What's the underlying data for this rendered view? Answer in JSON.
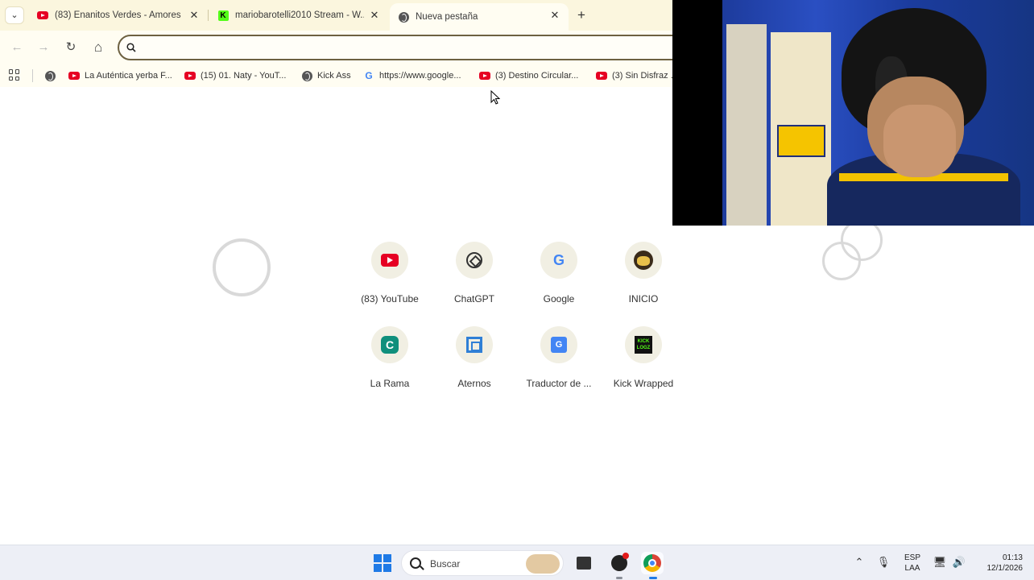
{
  "browser": {
    "tabs": [
      {
        "title": "(83) Enanitos Verdes - Amores ...",
        "favicon": "youtube-icon",
        "active": false
      },
      {
        "title": "mariobarotelli2010 Stream - W...",
        "favicon": "kick-icon",
        "active": false
      },
      {
        "title": "Nueva pestaña",
        "favicon": "globe-icon",
        "active": true
      }
    ],
    "tab_close_glyph": "✕",
    "new_tab_glyph": "+",
    "tab_menu_glyph": "⌄",
    "toolbar": {
      "back_glyph": "←",
      "forward_glyph": "→",
      "reload_glyph": "↻",
      "home_glyph": "⌂",
      "omnibox_value": ""
    },
    "bookmarks": [
      {
        "label": "",
        "favicon": "globe-icon"
      },
      {
        "label": "La Auténtica yerba F...",
        "favicon": "youtube-icon"
      },
      {
        "label": "(15) 01. Naty - YouT...",
        "favicon": "youtube-icon"
      },
      {
        "label": "Kick Ass",
        "favicon": "globe-icon"
      },
      {
        "label": "https://www.google...",
        "favicon": "google-icon"
      },
      {
        "label": "(3) Destino Circular...",
        "favicon": "youtube-icon"
      },
      {
        "label": "(3) Sin Disfraz ...",
        "favicon": "youtube-icon"
      }
    ]
  },
  "new_tab_page": {
    "shortcuts": [
      {
        "label": "(83) YouTube",
        "icon": "youtube-icon"
      },
      {
        "label": "ChatGPT",
        "icon": "chatgpt-icon"
      },
      {
        "label": "Google",
        "icon": "google-icon"
      },
      {
        "label": "INICIO",
        "icon": "inicio-icon"
      },
      {
        "label": "La Rama",
        "icon": "la-rama-icon"
      },
      {
        "label": "Aternos",
        "icon": "aternos-icon"
      },
      {
        "label": "Traductor de ...",
        "icon": "translate-icon"
      },
      {
        "label": "Kick Wrapped",
        "icon": "kick-icon"
      }
    ],
    "icon_glyphs": {
      "google": "G",
      "la_rama": "C",
      "translate": "G",
      "kick": "KICK LOGZ"
    }
  },
  "taskbar": {
    "search_placeholder": "Buscar",
    "language_line1": "ESP",
    "language_line2": "LAA",
    "time": "01:13",
    "date": "12/1/2026",
    "accent_color": "#1f7ae6"
  }
}
